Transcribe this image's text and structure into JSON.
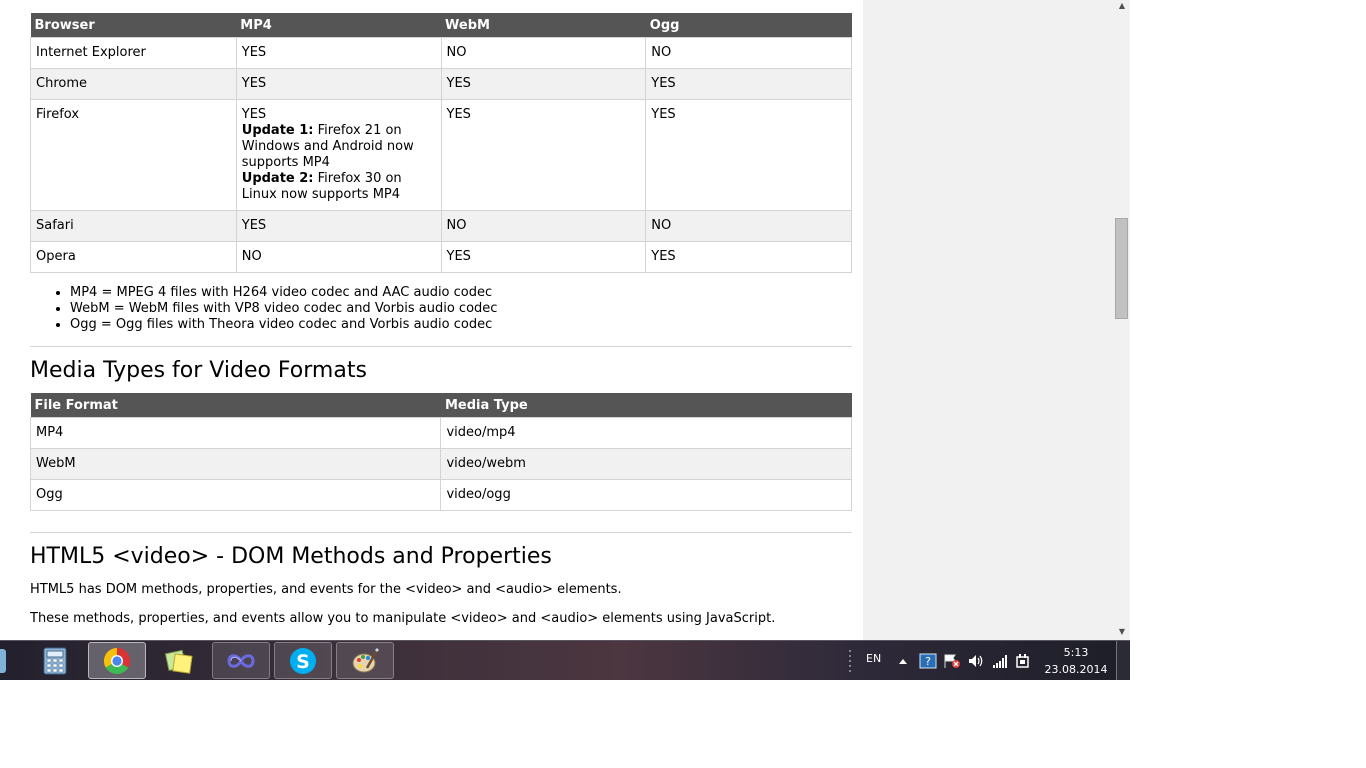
{
  "browser_support": {
    "headers": [
      "Browser",
      "MP4",
      "WebM",
      "Ogg"
    ],
    "rows": [
      {
        "browser": "Internet Explorer",
        "mp4": "YES",
        "webm": "NO",
        "ogg": "NO"
      },
      {
        "browser": "Chrome",
        "mp4": "YES",
        "webm": "YES",
        "ogg": "YES"
      },
      {
        "browser": "Firefox",
        "mp4": "YES",
        "update1_label": "Update 1:",
        "update1_text": " Firefox 21 on Windows and Android now supports MP4",
        "update2_label": "Update 2:",
        "update2_text": " Firefox 30 on Linux now supports MP4",
        "webm": "YES",
        "ogg": "YES"
      },
      {
        "browser": "Safari",
        "mp4": "YES",
        "webm": "NO",
        "ogg": "NO"
      },
      {
        "browser": "Opera",
        "mp4": "NO",
        "webm": "YES",
        "ogg": "YES"
      }
    ]
  },
  "notes": [
    "MP4 = MPEG 4 files with H264 video codec and AAC audio codec",
    "WebM = WebM files with VP8 video codec and Vorbis audio codec",
    "Ogg = Ogg files with Theora video codec and Vorbis audio codec"
  ],
  "media_types": {
    "heading": "Media Types for Video Formats",
    "headers": [
      "File Format",
      "Media Type"
    ],
    "rows": [
      {
        "format": "MP4",
        "type": "video/mp4"
      },
      {
        "format": "WebM",
        "type": "video/webm"
      },
      {
        "format": "Ogg",
        "type": "video/ogg"
      }
    ]
  },
  "dom_section": {
    "heading": "HTML5 <video> - DOM Methods and Properties",
    "para1": "HTML5 has DOM methods, properties, and events for the <video> and <audio> elements.",
    "para2": "These methods, properties, and events allow you to manipulate <video> and <audio> elements using JavaScript."
  },
  "taskbar": {
    "apps": [
      {
        "name": "calculator",
        "icon": "calculator-icon",
        "state": "pinned"
      },
      {
        "name": "chrome",
        "icon": "chrome-icon",
        "state": "active"
      },
      {
        "name": "sticky-notes",
        "icon": "sticky-notes-icon",
        "state": "pinned"
      },
      {
        "name": "infinity-app",
        "icon": "infinity-icon",
        "state": "open"
      },
      {
        "name": "skype",
        "icon": "skype-icon",
        "state": "open"
      },
      {
        "name": "paint",
        "icon": "paint-icon",
        "state": "open"
      }
    ],
    "language": "EN",
    "time": "5:13",
    "date": "23.08.2014"
  },
  "colors": {
    "table_header_bg": "#555555",
    "row_alt_bg": "#f1f1f1",
    "panel_bg": "#f1f1f1",
    "skype_blue": "#00aff0"
  }
}
